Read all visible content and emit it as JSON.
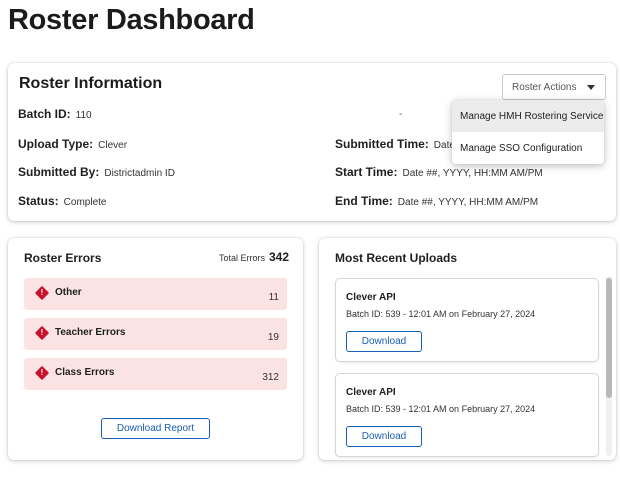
{
  "page": {
    "title": "Roster Dashboard"
  },
  "info": {
    "title": "Roster Information",
    "actions_label": "Roster Actions",
    "separator": "-",
    "fields": {
      "batch_id": {
        "label": "Batch ID:",
        "value": "110"
      },
      "upload_type": {
        "label": "Upload Type:",
        "value": "Clever"
      },
      "submitted_by": {
        "label": "Submitted By:",
        "value": "Districtadmin ID"
      },
      "status": {
        "label": "Status:",
        "value": "Complete"
      },
      "submitted_time": {
        "label": "Submitted Time:",
        "value": "Date"
      },
      "start_time": {
        "label": "Start Time:",
        "value": "Date ##, YYYY, HH:MM AM/PM"
      },
      "end_time": {
        "label": "End Time:",
        "value": "Date ##, YYYY, HH:MM AM/PM"
      }
    },
    "menu": {
      "items": [
        {
          "label": "Manage HMH Rostering Service",
          "highlighted": true
        },
        {
          "label": "Manage SSO Configuration",
          "highlighted": false
        }
      ]
    }
  },
  "errors": {
    "title": "Roster Errors",
    "total_label": "Total Errors",
    "total_value": "342",
    "rows": [
      {
        "label": "Other",
        "count": "11"
      },
      {
        "label": "Teacher Errors",
        "count": "19"
      },
      {
        "label": "Class Errors",
        "count": "312"
      }
    ],
    "download_label": "Download Report"
  },
  "uploads": {
    "title": "Most Recent Uploads",
    "items": [
      {
        "title": "Clever API",
        "meta": "Batch ID: 539 - 12:01 AM on February 27, 2024",
        "download_label": "Download"
      },
      {
        "title": "Clever API",
        "meta": "Batch ID: 539 - 12:01 AM on February 27, 2024",
        "download_label": "Download"
      }
    ]
  },
  "colors": {
    "accent": "#1a5fb4",
    "error_icon": "#c8102e",
    "error_row_bg": "#fbe3e3",
    "menu_hover": "#ececec"
  },
  "icons": {
    "actions_caret": "caret-down-icon",
    "error": "error-diamond-icon"
  }
}
